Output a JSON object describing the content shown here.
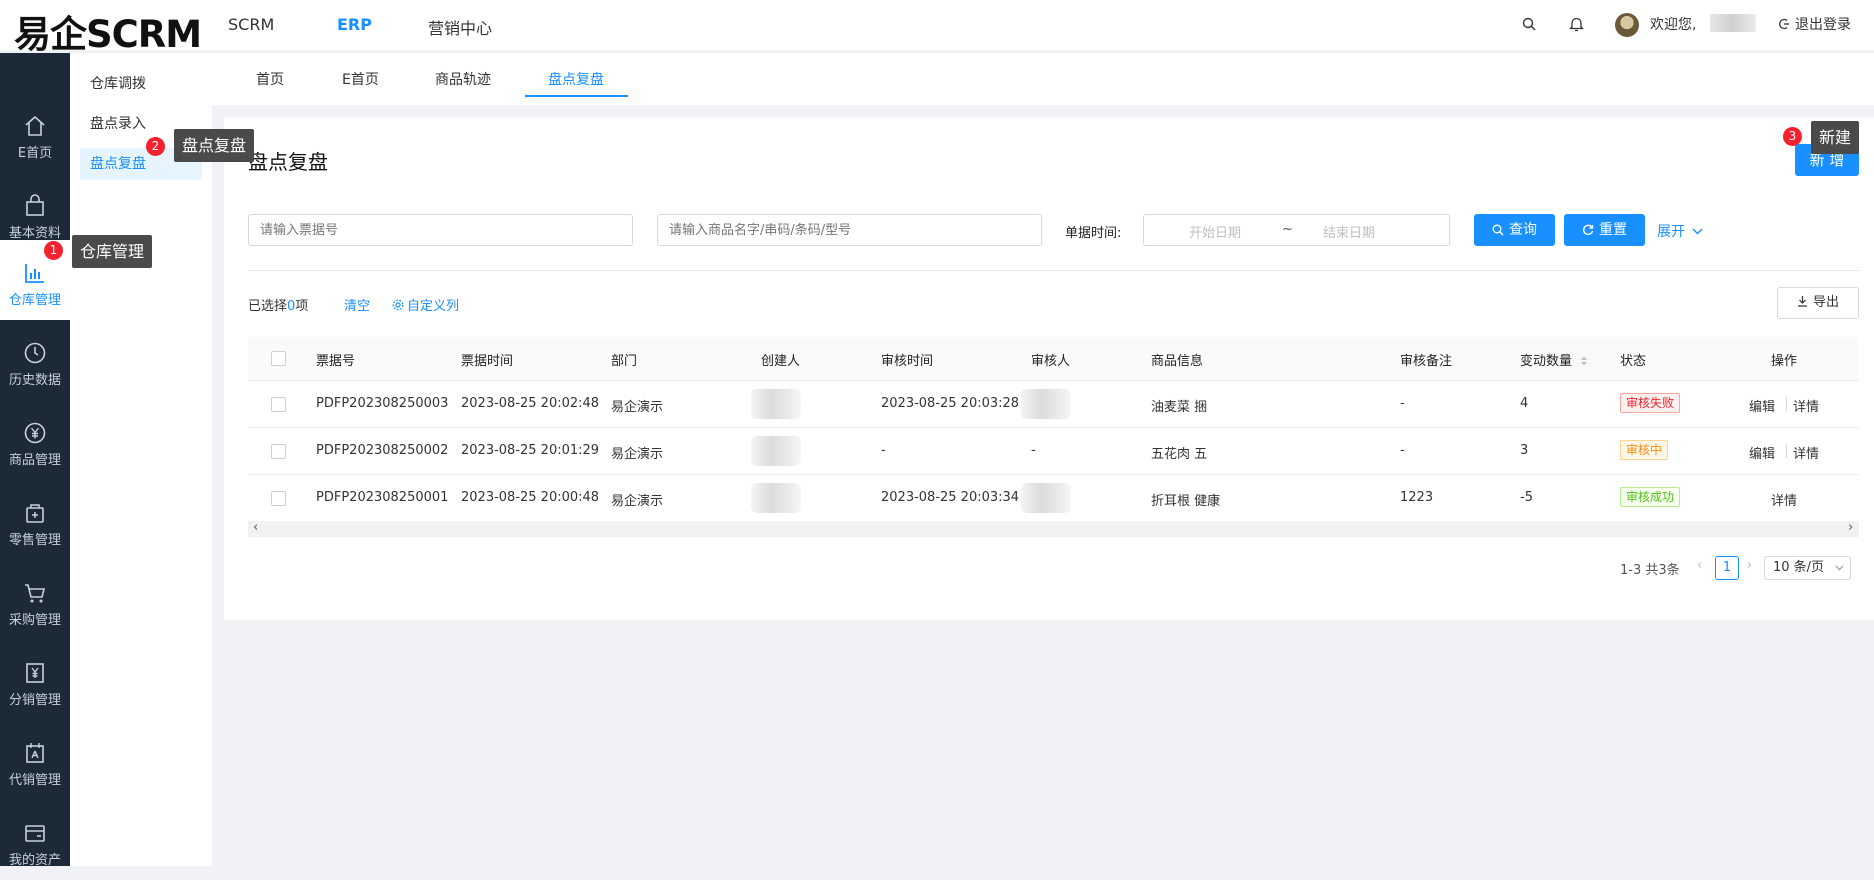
{
  "app": {
    "logo": "易企SCRM"
  },
  "topnav": [
    {
      "label": "SCRM"
    },
    {
      "label": "ERP"
    },
    {
      "label": "营销中心"
    }
  ],
  "header": {
    "welcome": "欢迎您,",
    "logout": "退出登录"
  },
  "sidebar": {
    "items": [
      {
        "label": "E首页",
        "icon": "home-icon"
      },
      {
        "label": "基本资料",
        "icon": "bag-icon"
      },
      {
        "label": "仓库管理",
        "icon": "bar-chart-icon"
      },
      {
        "label": "历史数据",
        "icon": "clock-icon"
      },
      {
        "label": "商品管理",
        "icon": "yen-circle-icon"
      },
      {
        "label": "零售管理",
        "icon": "store-icon"
      },
      {
        "label": "采购管理",
        "icon": "cart-icon"
      },
      {
        "label": "分销管理",
        "icon": "yen-doc-icon"
      },
      {
        "label": "代销管理",
        "icon": "agent-icon"
      },
      {
        "label": "我的资产",
        "icon": "wallet-icon"
      }
    ]
  },
  "submenu": {
    "items": [
      {
        "label": "仓库调拨"
      },
      {
        "label": "盘点录入"
      },
      {
        "label": "盘点复盘"
      }
    ]
  },
  "tabs": [
    {
      "label": "首页"
    },
    {
      "label": "E首页"
    },
    {
      "label": "商品轨迹"
    },
    {
      "label": "盘点复盘"
    }
  ],
  "page": {
    "title": "盘点复盘",
    "new_button": "新 增"
  },
  "filters": {
    "ticket_placeholder": "请输入票据号",
    "product_placeholder": "请输入商品名字/串码/条码/型号",
    "date_label": "单据时间:",
    "start_placeholder": "开始日期",
    "range_sep": "~",
    "end_placeholder": "结束日期",
    "query": "查询",
    "reset": "重置",
    "expand": "展开"
  },
  "toolbar": {
    "selected_prefix": "已选择",
    "selected_count": "0",
    "selected_suffix": "项",
    "clear": "清空",
    "custom_columns": "自定义列",
    "export": "导出"
  },
  "table": {
    "columns": [
      "票据号",
      "票据时间",
      "部门",
      "创建人",
      "审核时间",
      "审核人",
      "商品信息",
      "审核备注",
      "变动数量",
      "状态",
      "操作"
    ],
    "rows": [
      {
        "no": "PDFP202308250003",
        "time": "2023-08-25 20:02:48",
        "dept": "易企演示",
        "audit_time": "2023-08-25 20:03:28",
        "auditor": "",
        "product": "油麦菜 捆",
        "remark": "-",
        "qty": "4",
        "status": "审核失败",
        "actions": [
          "编辑",
          "详情"
        ]
      },
      {
        "no": "PDFP202308250002",
        "time": "2023-08-25 20:01:29",
        "dept": "易企演示",
        "audit_time": "-",
        "auditor": "-",
        "product": "五花肉 五",
        "remark": "-",
        "qty": "3",
        "status": "审核中",
        "actions": [
          "编辑",
          "详情"
        ]
      },
      {
        "no": "PDFP202308250001",
        "time": "2023-08-25 20:00:48",
        "dept": "易企演示",
        "audit_time": "2023-08-25 20:03:34",
        "auditor": "",
        "product": "折耳根 健康",
        "remark": "1223",
        "qty": "-5",
        "status": "审核成功",
        "actions": [
          "详情"
        ]
      }
    ]
  },
  "pagination": {
    "summary": "1-3 共3条",
    "current": "1",
    "page_size": "10 条/页"
  },
  "tour": [
    {
      "num": "1",
      "text": "仓库管理"
    },
    {
      "num": "2",
      "text": "盘点复盘"
    },
    {
      "num": "3",
      "text": "新建"
    }
  ],
  "colors": {
    "accent": "#1890ff",
    "sidebar_bg": "#1c2a38",
    "fail": "#f5222d",
    "pending": "#fa8c16",
    "success": "#52c41a"
  }
}
